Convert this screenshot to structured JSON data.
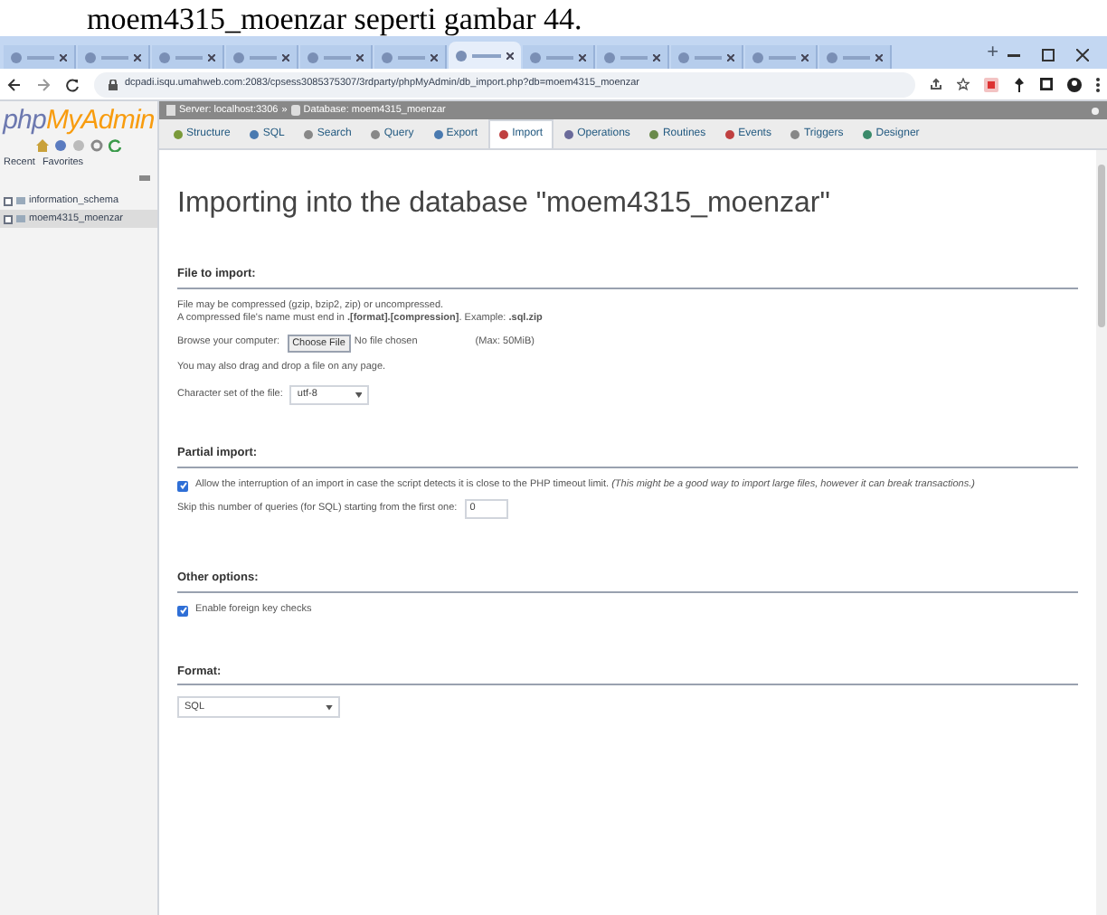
{
  "caption": "moem4315_moenzar seperti gambar 44.",
  "browser": {
    "tabs": [
      {
        "selected": false
      },
      {
        "selected": false
      },
      {
        "selected": false
      },
      {
        "selected": false
      },
      {
        "selected": false
      },
      {
        "selected": false
      },
      {
        "selected": true
      },
      {
        "selected": false
      },
      {
        "selected": false
      },
      {
        "selected": false
      },
      {
        "selected": false
      },
      {
        "selected": false
      }
    ],
    "new_tab": "+",
    "url": "dcpadi.isqu.umahweb.com:2083/cpsess3085375307/3rdparty/phpMyAdmin/db_import.php?db=moem4315_moenzar"
  },
  "sidebar": {
    "logo_part_1": "php",
    "logo_part_2": "MyAdmin",
    "links": [
      "Recent",
      "Favorites"
    ],
    "databases": [
      {
        "name": "information_schema",
        "selected": false
      },
      {
        "name": "moem4315_moenzar",
        "selected": true
      }
    ]
  },
  "breadcrumb": [
    "Server: localhost:3306",
    "Database: moem4315_moenzar"
  ],
  "breadcrumb_separator": "»",
  "nav_tabs": [
    {
      "label": "Structure",
      "selected": false
    },
    {
      "label": "SQL",
      "selected": false
    },
    {
      "label": "Search",
      "selected": false
    },
    {
      "label": "Query",
      "selected": false
    },
    {
      "label": "Export",
      "selected": false
    },
    {
      "label": "Import",
      "selected": true
    },
    {
      "label": "Operations",
      "selected": false
    },
    {
      "label": "Routines",
      "selected": false
    },
    {
      "label": "Events",
      "selected": false
    },
    {
      "label": "Triggers",
      "selected": false
    },
    {
      "label": "Designer",
      "selected": false
    }
  ],
  "heading": "Importing into the database \"moem4315_moenzar\"",
  "file_section": {
    "title": "File to import:",
    "note_1": "File may be compressed (gzip, bzip2, zip) or uncompressed.",
    "note_2": "A compressed file's name must end in **.[format].[compression]**. Example: **.sql.zip**",
    "browse_label": "Browse your computer:",
    "choose_button": "Choose File",
    "file_status": "No file chosen",
    "max_size": "(Max: 50MiB)",
    "drag_note": "You may also drag and drop a file on any page.",
    "charset_label": "Character set of the file:",
    "charset_value": "utf-8"
  },
  "partial_section": {
    "title": "Partial import:",
    "allow_interrupt": {
      "checked": true,
      "text": "Allow the interruption of an import in case the script detects it is close to the PHP timeout limit. *(This might be a good way to import large files, however it can break transactions.)*"
    },
    "skip_label": "Skip this number of queries (for SQL) starting from the first one:",
    "skip_value": "0"
  },
  "other_section": {
    "title": "Other options:",
    "foreign_keys": {
      "checked": true,
      "text": "Enable foreign key checks"
    }
  },
  "format_section": {
    "title": "Format:",
    "format_value": "SQL"
  }
}
